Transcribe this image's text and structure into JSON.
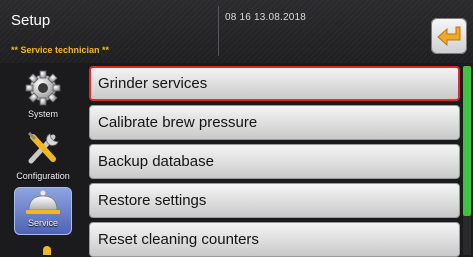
{
  "header": {
    "title": "Setup",
    "datetime": "08 16 13.08.2018",
    "role": "** Service technician **"
  },
  "sidebar": {
    "items": [
      {
        "label": "System",
        "icon": "gear-icon",
        "active": false
      },
      {
        "label": "Configuration",
        "icon": "tools-icon",
        "active": false
      },
      {
        "label": "Service",
        "icon": "service-bell-icon",
        "active": true
      }
    ]
  },
  "menu": {
    "items": [
      {
        "label": "Grinder services",
        "selected": true
      },
      {
        "label": "Calibrate brew pressure",
        "selected": false
      },
      {
        "label": "Backup database",
        "selected": false
      },
      {
        "label": "Restore settings",
        "selected": false
      },
      {
        "label": "Reset cleaning counters",
        "selected": false
      }
    ]
  },
  "colors": {
    "accent_orange": "#f2b81f",
    "selection_red": "#e02b2b",
    "scroll_green": "#3cc43c",
    "active_blue": "#4e63b5"
  }
}
